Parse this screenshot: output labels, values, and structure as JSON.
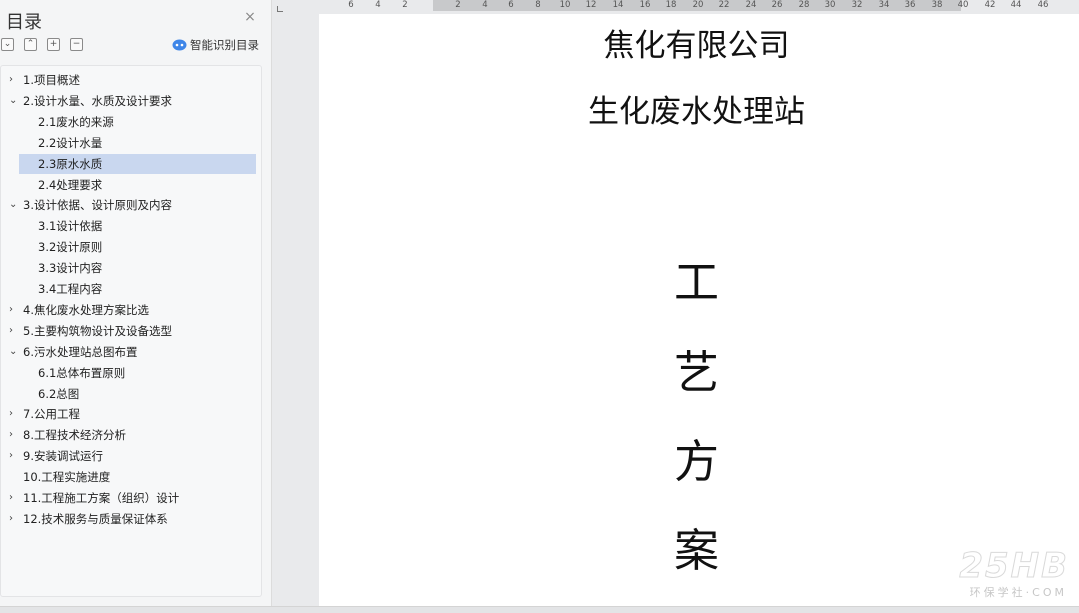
{
  "toc": {
    "title": "目录",
    "close_glyph": "×",
    "tools": [
      {
        "name": "collapse-all-icon",
        "glyph": "⌄"
      },
      {
        "name": "expand-all-icon",
        "glyph": "⌃"
      },
      {
        "name": "add-heading-icon",
        "glyph": "+"
      },
      {
        "name": "remove-heading-icon",
        "glyph": "−"
      }
    ],
    "smart_label": "智能识别目录",
    "items": [
      {
        "label": "1.项目概述",
        "level": 1,
        "arrow": "›"
      },
      {
        "label": "2.设计水量、水质及设计要求",
        "level": 1,
        "arrow": "⌄"
      },
      {
        "label": "2.1废水的来源",
        "level": 2,
        "arrow": ""
      },
      {
        "label": "2.2设计水量",
        "level": 2,
        "arrow": ""
      },
      {
        "label": "2.3原水水质",
        "level": 2,
        "arrow": "",
        "selected": true
      },
      {
        "label": "2.4处理要求",
        "level": 2,
        "arrow": ""
      },
      {
        "label": "3.设计依据、设计原则及内容",
        "level": 1,
        "arrow": "⌄"
      },
      {
        "label": "3.1设计依据",
        "level": 2,
        "arrow": ""
      },
      {
        "label": "3.2设计原则",
        "level": 2,
        "arrow": ""
      },
      {
        "label": "3.3设计内容",
        "level": 2,
        "arrow": ""
      },
      {
        "label": "3.4工程内容",
        "level": 2,
        "arrow": ""
      },
      {
        "label": "4.焦化废水处理方案比选",
        "level": 1,
        "arrow": "›"
      },
      {
        "label": "5.主要构筑物设计及设备选型",
        "level": 1,
        "arrow": "›"
      },
      {
        "label": "6.污水处理站总图布置",
        "level": 1,
        "arrow": "⌄"
      },
      {
        "label": "6.1总体布置原则",
        "level": 2,
        "arrow": ""
      },
      {
        "label": "6.2总图",
        "level": 2,
        "arrow": ""
      },
      {
        "label": "7.公用工程",
        "level": 1,
        "arrow": "›"
      },
      {
        "label": "8.工程技术经济分析",
        "level": 1,
        "arrow": "›"
      },
      {
        "label": "9.安装调试运行",
        "level": 1,
        "arrow": "›"
      },
      {
        "label": "10.工程实施进度",
        "level": 1,
        "arrow": ""
      },
      {
        "label": "11.工程施工方案（组织）设计",
        "level": 1,
        "arrow": "›"
      },
      {
        "label": "12.技术服务与质量保证体系",
        "level": 1,
        "arrow": "›"
      }
    ]
  },
  "ruler": {
    "ticks": [
      "6",
      "4",
      "2",
      "2",
      "4",
      "6",
      "8",
      "10",
      "12",
      "14",
      "16",
      "18",
      "20",
      "22",
      "24",
      "26",
      "28",
      "30",
      "32",
      "34",
      "36",
      "38",
      "40",
      "42",
      "44",
      "46"
    ]
  },
  "document": {
    "company": "焦化有限公司",
    "station": "生化废水处理站",
    "vertical_title": [
      "工",
      "艺",
      "方",
      "案"
    ]
  },
  "watermark": {
    "logo": "25HB",
    "sub": "环保学社·COM"
  },
  "colors": {
    "selected_row": "#c9d7ef",
    "panel_bg": "#f4f5f6",
    "smart_icon": "#3f86e8"
  }
}
